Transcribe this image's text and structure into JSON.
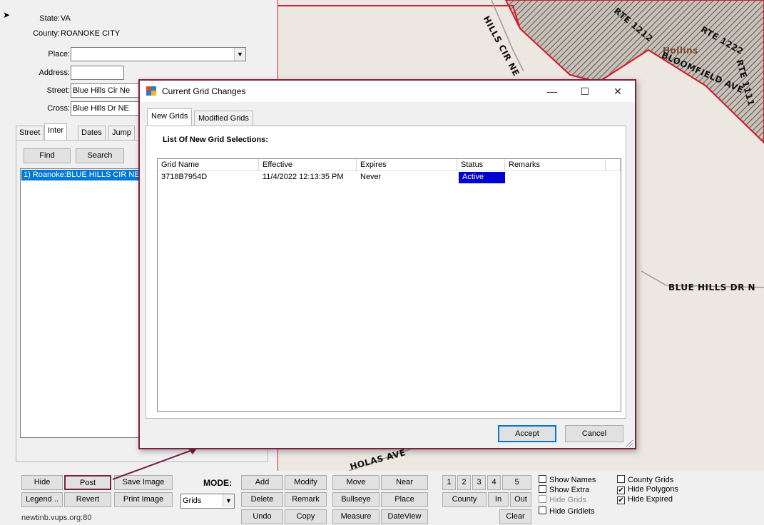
{
  "left_panel": {
    "state_label": "State:",
    "state_value": "VA",
    "county_label": "County:",
    "county_value": "ROANOKE CITY",
    "place_label": "Place:",
    "place_value": "",
    "address_label": "Address:",
    "address_value": "",
    "street_label": "Street:",
    "street_value": "Blue Hills Cir Ne",
    "cross_label": "Cross:",
    "cross_value": "Blue Hills Dr NE",
    "tabs": [
      "Street",
      "Inter",
      "Dates",
      "Jump"
    ],
    "find_button": "Find",
    "search_button": "Search",
    "results": [
      "1) Roanoke:BLUE HILLS CIR NE"
    ]
  },
  "map": {
    "labels": {
      "hills_cir": "HILLS CIR NE",
      "rte1212": "RTE 1212",
      "rte1222": "RTE 1222",
      "hollins": "Hollins",
      "bloomfield": "BLOOMFIELD AVE",
      "rte_right": "RTE 1111",
      "blue_hills_dr": "BLUE HILLS DR N",
      "nicholas": "HOLAS AVE"
    },
    "colors": {
      "parcel": "#ede7e1",
      "boundary": "#d02030",
      "hatch": "#555555"
    }
  },
  "dialog": {
    "title": "Current Grid Changes",
    "tabs": [
      "New Grids",
      "Modified Grids"
    ],
    "heading": "List Of New Grid Selections:",
    "columns": [
      "Grid Name",
      "Effective",
      "Expires",
      "Status",
      "Remarks"
    ],
    "rows": [
      {
        "grid_name": "3718B7954D",
        "effective": "11/4/2022 12:13:35 PM",
        "expires": "Never",
        "status": "Active",
        "remarks": ""
      }
    ],
    "accept_button": "Accept",
    "cancel_button": "Cancel",
    "minimize": "—",
    "maximize": "☐",
    "close": "✕"
  },
  "toolbar": {
    "hide": "Hide",
    "post": "Post",
    "save_image": "Save Image",
    "legend": "Legend ..",
    "revert": "Revert",
    "print_image": "Print Image",
    "server": "newtinb.vups.org:80",
    "mode_label": "MODE:",
    "mode_value": "Grids",
    "add": "Add",
    "modify": "Modify",
    "delete": "Delete",
    "remark": "Remark",
    "undo": "Undo",
    "copy": "Copy",
    "move": "Move",
    "near": "Near",
    "bullseye": "Bullseye",
    "place": "Place",
    "measure": "Measure",
    "dateview": "DateView",
    "zoom_levels": [
      "1",
      "2",
      "3",
      "4",
      "5"
    ],
    "county": "County",
    "in": "In",
    "out": "Out",
    "clear": "Clear",
    "checks": {
      "show_names": "Show Names",
      "show_extra": "Show Extra",
      "hide_grids": "Hide Grids",
      "hide_gridlets": "Hide Gridlets",
      "county_grids": "County Grids",
      "hide_polygons": "Hide Polygons",
      "hide_expired": "Hide Expired"
    }
  }
}
